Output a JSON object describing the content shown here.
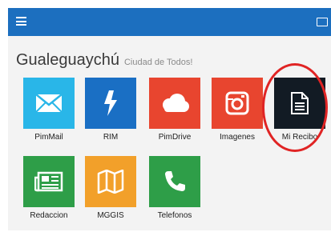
{
  "header": {
    "menu_icon": "hamburger-menu-icon",
    "right_icon": "keyboard-icon",
    "bar_color": "#1c6fbf"
  },
  "page": {
    "title": "Gualeguaychú",
    "subtitle": "Ciudad de Todos!"
  },
  "apps": [
    {
      "label": "PimMail",
      "icon": "envelope-icon",
      "color": "#29b6e8"
    },
    {
      "label": "RIM",
      "icon": "lightning-icon",
      "color": "#1a6fc4"
    },
    {
      "label": "PimDrive",
      "icon": "cloud-icon",
      "color": "#e8452f"
    },
    {
      "label": "Imagenes",
      "icon": "camera-icon",
      "color": "#e8452f"
    },
    {
      "label": "Mi Recibo",
      "icon": "document-icon",
      "color": "#121b24"
    },
    {
      "label": "Redaccion",
      "icon": "newspaper-icon",
      "color": "#2e9e48"
    },
    {
      "label": "MGGIS",
      "icon": "map-icon",
      "color": "#f2a02a"
    },
    {
      "label": "Telefonos",
      "icon": "phone-icon",
      "color": "#2e9e48"
    }
  ],
  "highlight_color": "#e02424"
}
